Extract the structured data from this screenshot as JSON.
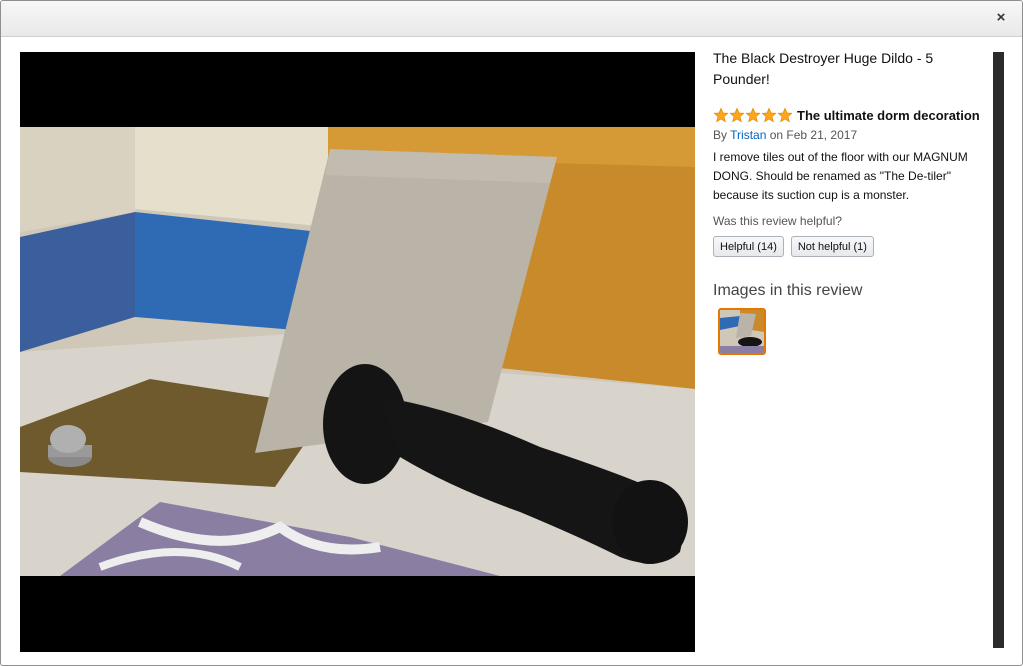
{
  "header": {
    "close_symbol": "×"
  },
  "product": {
    "title": "The Black Destroyer Huge Dildo - 5 Pounder!"
  },
  "review": {
    "rating": 5,
    "title": "The ultimate dorm decoration",
    "by_prefix": "By",
    "author": "Tristan",
    "date_text": "on Feb 21, 2017",
    "body": "I remove tiles out of the floor with our MAGNUM DONG. Should be renamed as \"The De-tiler\" because its suction cup is a monster.",
    "helpful_question": "Was this review helpful?",
    "helpful_label": "Helpful (14)",
    "not_helpful_label": "Not helpful (1)"
  },
  "images_section": {
    "heading": "Images in this review"
  },
  "colors": {
    "star": "#ffa41c",
    "link": "#0066c0",
    "thumb_border": "#e77600",
    "scrollbar": "#2b2b2b"
  },
  "icons": [
    "close-icon",
    "star-icon",
    "review-photo"
  ]
}
